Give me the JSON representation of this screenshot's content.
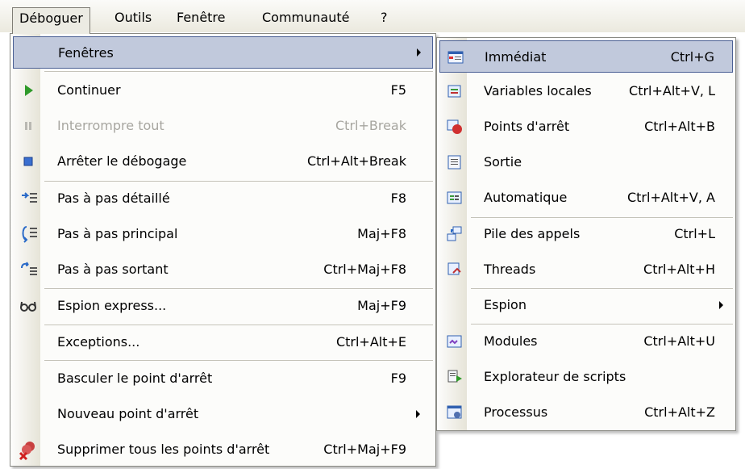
{
  "menubar": {
    "items": [
      "Déboguer",
      "Outils",
      "Fenêtre",
      "Communauté",
      "?"
    ]
  },
  "debug_menu": {
    "items": [
      {
        "label": "Fenêtres",
        "shortcut": "",
        "icon": "",
        "submenu": true
      },
      {
        "label": "Continuer",
        "shortcut": "F5",
        "icon": "play-icon"
      },
      {
        "label": "Interrompre tout",
        "shortcut": "Ctrl+Break",
        "icon": "pause-icon",
        "disabled": true
      },
      {
        "label": "Arrêter le débogage",
        "shortcut": "Ctrl+Alt+Break",
        "icon": "stop-icon"
      },
      {
        "label": "Pas à pas détaillé",
        "shortcut": "F8",
        "icon": "step-into-icon"
      },
      {
        "label": "Pas à pas principal",
        "shortcut": "Maj+F8",
        "icon": "step-over-icon"
      },
      {
        "label": "Pas à pas sortant",
        "shortcut": "Ctrl+Maj+F8",
        "icon": "step-out-icon"
      },
      {
        "label": "Espion express...",
        "shortcut": "Maj+F9",
        "icon": "glasses-icon"
      },
      {
        "label": "Exceptions...",
        "shortcut": "Ctrl+Alt+E",
        "icon": ""
      },
      {
        "label": "Basculer le point d'arrêt",
        "shortcut": "F9",
        "icon": ""
      },
      {
        "label": "Nouveau point d'arrêt",
        "shortcut": "",
        "icon": "",
        "submenu": true
      },
      {
        "label": "Supprimer tous les points d'arrêt",
        "shortcut": "Ctrl+Maj+F9",
        "icon": "delete-breakpoints-icon"
      }
    ]
  },
  "windows_submenu": {
    "items": [
      {
        "label": "Immédiat",
        "shortcut": "Ctrl+G",
        "icon": "immediate-window-icon"
      },
      {
        "label": "Variables locales",
        "shortcut": "Ctrl+Alt+V, L",
        "icon": "locals-icon"
      },
      {
        "label": "Points d'arrêt",
        "shortcut": "Ctrl+Alt+B",
        "icon": "breakpoints-icon"
      },
      {
        "label": "Sortie",
        "shortcut": "",
        "icon": "output-icon"
      },
      {
        "label": "Automatique",
        "shortcut": "Ctrl+Alt+V, A",
        "icon": "autos-icon"
      },
      {
        "label": "Pile des appels",
        "shortcut": "Ctrl+L",
        "icon": "call-stack-icon"
      },
      {
        "label": "Threads",
        "shortcut": "Ctrl+Alt+H",
        "icon": "threads-icon"
      },
      {
        "label": "Espion",
        "shortcut": "",
        "icon": "",
        "submenu": true
      },
      {
        "label": "Modules",
        "shortcut": "Ctrl+Alt+U",
        "icon": "modules-icon"
      },
      {
        "label": "Explorateur de scripts",
        "shortcut": "",
        "icon": "script-explorer-icon"
      },
      {
        "label": "Processus",
        "shortcut": "Ctrl+Alt+Z",
        "icon": "processes-icon"
      }
    ]
  }
}
